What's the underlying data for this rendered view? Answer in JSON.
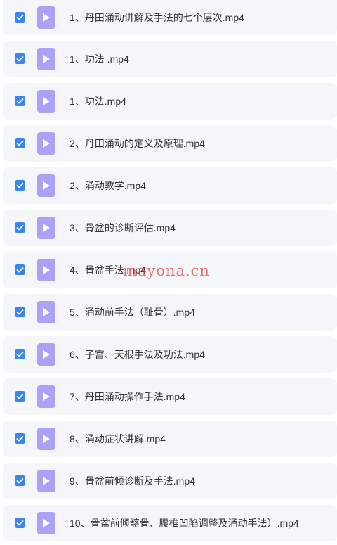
{
  "files": [
    {
      "name": "1、丹田涌动讲解及手法的七个层次.mp4",
      "checked": true
    },
    {
      "name": "1、功法 .mp4",
      "checked": true
    },
    {
      "name": "1、功法.mp4",
      "checked": true
    },
    {
      "name": "2、丹田涌动的定义及原理.mp4",
      "checked": true
    },
    {
      "name": "2、涌动教学.mp4",
      "checked": true
    },
    {
      "name": "3、骨盆的诊断评估.mp4",
      "checked": true
    },
    {
      "name": "4、骨盆手法.mp4",
      "checked": true
    },
    {
      "name": "5、涌动前手法（耻骨）.mp4",
      "checked": true
    },
    {
      "name": "6、子宫、天根手法及功法.mp4",
      "checked": true
    },
    {
      "name": "7、丹田涌动操作手法.mp4",
      "checked": true
    },
    {
      "name": "8、涌动症状讲解.mp4",
      "checked": true
    },
    {
      "name": "9、骨盆前倾诊断及手法.mp4",
      "checked": true
    },
    {
      "name": "10、骨盆前倾髂骨、腰椎凹陷调整及涌动手法）.mp4",
      "checked": true
    }
  ],
  "watermark": "mayona.cn",
  "colors": {
    "checkbox": "#3a86f0",
    "file_icon": "#a9a2f6",
    "row_background": "#f5f6f9",
    "text": "#333333",
    "watermark": "#e83b3b"
  },
  "icons": {
    "checkbox": "checkmark-icon",
    "file": "video-play-icon"
  }
}
